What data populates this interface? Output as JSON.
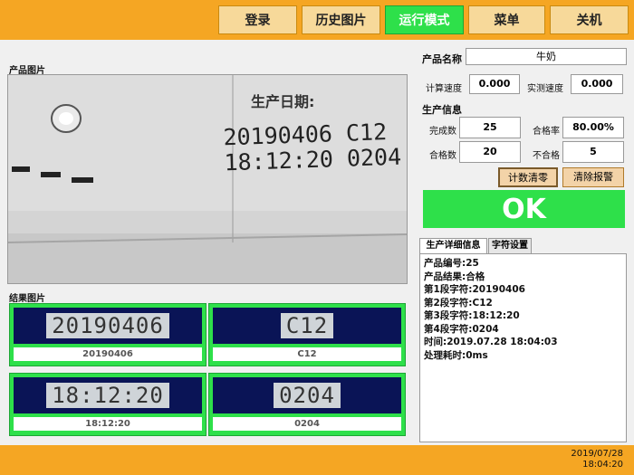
{
  "topbar": {
    "buttons": [
      {
        "label": "登录",
        "active": false
      },
      {
        "label": "历史图片",
        "active": false
      },
      {
        "label": "运行模式",
        "active": true
      },
      {
        "label": "菜单",
        "active": false
      },
      {
        "label": "关机",
        "active": false
      }
    ]
  },
  "left": {
    "camera_title": "产品图片",
    "camera_text": {
      "header": "生产日期:",
      "line1": "20190406 C12",
      "line2": "18:12:20 0204"
    },
    "result_title": "结果图片",
    "results": [
      {
        "image_text": "20190406",
        "caption": "20190406"
      },
      {
        "image_text": "C12",
        "caption": "C12"
      },
      {
        "image_text": "18:12:20",
        "caption": "18:12:20"
      },
      {
        "image_text": "0204",
        "caption": "0204"
      }
    ]
  },
  "right": {
    "product_name_label": "产品名称",
    "product_name": "牛奶",
    "calc_speed_label": "计算速度",
    "calc_speed": "0.000",
    "measured_speed_label": "实测速度",
    "measured_speed": "0.000",
    "production_info_label": "生产信息",
    "completed_label": "完成数",
    "completed": "25",
    "pass_rate_label": "合格率",
    "pass_rate": "80.00%",
    "pass_count_label": "合格数",
    "pass_count": "20",
    "fail_label": "不合格",
    "fail_count": "5",
    "reset_count_btn": "计数清零",
    "clear_alarm_btn": "清除报警",
    "status": "OK",
    "status_color": "#2ee04a",
    "tabs": [
      "生产详细信息",
      "字符设置"
    ],
    "detail_lines": [
      "产品编号:25",
      "产品结果:合格",
      "第1段字符:20190406",
      "第2段字符:C12",
      "第3段字符:18:12:20",
      "第4段字符:0204",
      "时间:2019.07.28 18:04:03",
      "处理耗时:0ms"
    ]
  },
  "footer": {
    "date": "2019/07/28",
    "time": "18:04:20"
  }
}
